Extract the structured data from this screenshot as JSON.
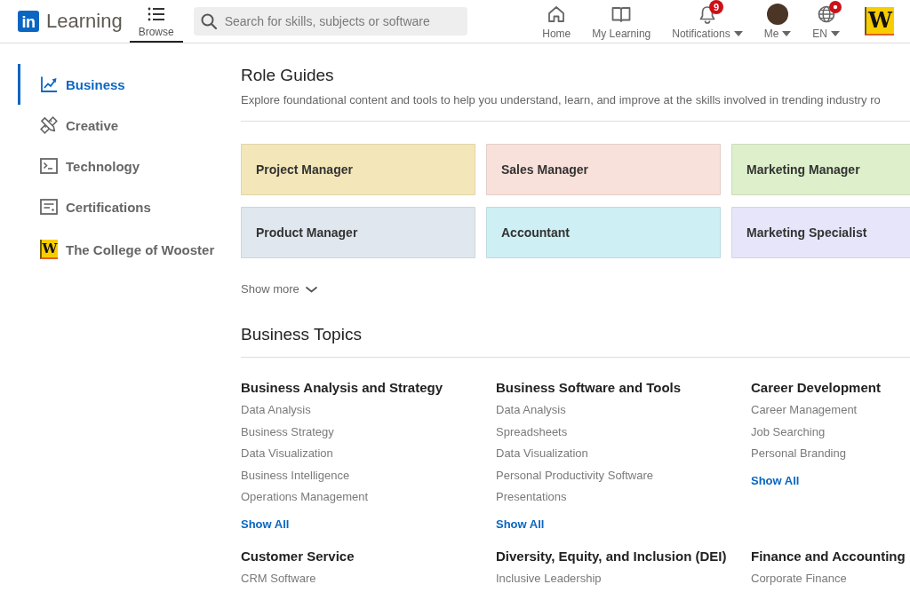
{
  "header": {
    "logo_text": "in",
    "product": "Learning",
    "browse": {
      "label": "Browse",
      "selected": true
    },
    "search": {
      "placeholder": "Search for skills, subjects or software"
    },
    "nav": [
      {
        "label": "Home",
        "kind": "icon",
        "selected": false,
        "dropdown": false,
        "alert_dot": false
      },
      {
        "label": "My Learning",
        "kind": "icon",
        "selected": false,
        "dropdown": false,
        "alert_dot": false
      },
      {
        "label": "Notifications",
        "kind": "icon",
        "badge": "9",
        "selected": false,
        "dropdown": true,
        "alert_dot": false
      },
      {
        "label": "Me",
        "kind": "avatar",
        "selected": false,
        "dropdown": true,
        "alert_dot": false
      },
      {
        "label": "EN",
        "kind": "icon",
        "selected": false,
        "dropdown": true,
        "alert_dot": true
      }
    ],
    "org_logo_text": "W"
  },
  "sidebar": {
    "items": [
      {
        "label": "Business",
        "kind": "category",
        "selected": true
      },
      {
        "label": "Creative",
        "kind": "category",
        "selected": false
      },
      {
        "label": "Technology",
        "kind": "category",
        "selected": false
      },
      {
        "label": "Certifications",
        "kind": "category",
        "selected": false
      },
      {
        "label": "The College of Wooster",
        "kind": "organization",
        "logo_text": "W",
        "selected": false
      }
    ]
  },
  "role_guides": {
    "title": "Role Guides",
    "description": "Explore foundational content and tools to help you understand, learn, and improve at the skills involved in trending industry ro",
    "cards": [
      {
        "label": "Project Manager",
        "color": "#f3e6b9"
      },
      {
        "label": "Sales Manager",
        "color": "#f8e1da"
      },
      {
        "label": "Marketing Manager",
        "color": "#ddefcb"
      },
      {
        "label": "Product Manager",
        "color": "#e1e7ee"
      },
      {
        "label": "Accountant",
        "color": "#ceeff3"
      },
      {
        "label": "Marketing Specialist",
        "color": "#e7e5fa"
      }
    ],
    "show_more": "Show more"
  },
  "business_topics": {
    "title": "Business Topics",
    "groups": [
      {
        "heading": "Business Analysis and Strategy",
        "items": [
          "Data Analysis",
          "Business Strategy",
          "Data Visualization",
          "Business Intelligence",
          "Operations Management"
        ],
        "link": "Show All"
      },
      {
        "heading": "Business Software and Tools",
        "items": [
          "Data Analysis",
          "Spreadsheets",
          "Data Visualization",
          "Personal Productivity Software",
          "Presentations"
        ],
        "link": "Show All"
      },
      {
        "heading": "Career Development",
        "items": [
          "Career Management",
          "Job Searching",
          "Personal Branding"
        ],
        "link": "Show All"
      },
      {
        "heading": "Customer Service",
        "items": [
          "CRM Software"
        ]
      },
      {
        "heading": "Diversity, Equity, and Inclusion (DEI)",
        "items": [
          "Inclusive Leadership"
        ]
      },
      {
        "heading": "Finance and Accounting",
        "items": [
          "Corporate Finance"
        ]
      }
    ]
  }
}
